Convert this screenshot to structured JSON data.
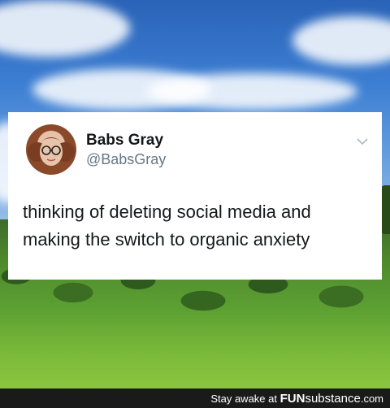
{
  "tweet": {
    "display_name": "Babs Gray",
    "handle": "@BabsGray",
    "text_line1": "thinking of deleting social media and",
    "text_line2": "making the switch to organic anxiety",
    "menu_icon": "chevron-down-icon",
    "avatar_icon": "avatar"
  },
  "footer": {
    "prefix": "Stay awake at ",
    "brand_fun": "FUN",
    "brand_substance": "substance",
    "brand_tld": ".com"
  },
  "colors": {
    "tweet_text": "#14171a",
    "handle": "#657786",
    "footer_bg": "#1a1a1a"
  }
}
